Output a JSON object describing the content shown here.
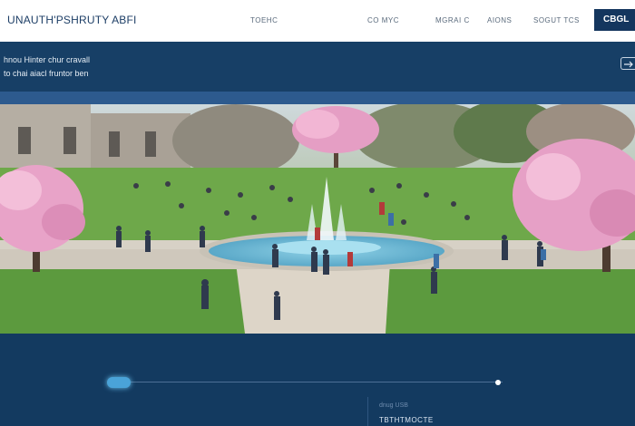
{
  "header": {
    "brand": "UNAUTH'PSHRUTY ABFI",
    "nav": [
      "TOEHC",
      "CO MYC",
      "MGRAI C",
      "AIONS",
      "SOGUT TCS"
    ],
    "cta_label": "CBGL"
  },
  "hero": {
    "line1": "hnou Hinter chur cravall",
    "line2": "to chai aiacl fruntor ben",
    "arrow_icon": "arrow-right-icon"
  },
  "photo": {
    "description_icon": "campus-photo"
  },
  "footer": {
    "progress": 0.0,
    "small_label": "dnug USB",
    "text": "TBTHTMOCTE"
  },
  "colors": {
    "navy": "#14365e",
    "hero_blue": "#173f66",
    "stripe_blue": "#2d5a8e",
    "footer_blue": "#133a60",
    "accent": "#4aa3d8"
  }
}
